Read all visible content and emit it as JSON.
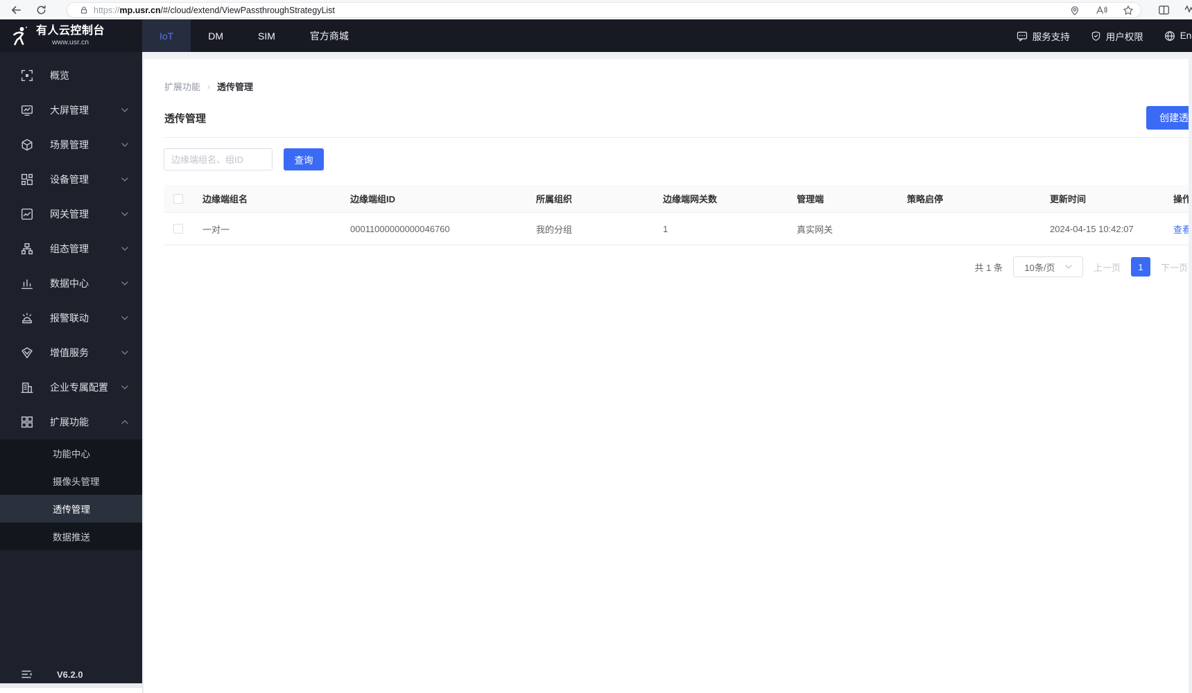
{
  "colors": {
    "accent": "#3b6bf5",
    "toggle_on": "#3e7bfa",
    "navbar_bg": "#171a23",
    "sidebar_bg": "#1c212b"
  },
  "browser": {
    "url_prefix": "https://",
    "url_host": "mp.usr.cn",
    "url_path": "/#/cloud/extend/ViewPassthroughStrategyList"
  },
  "topnav": {
    "logo_title": "有人云控制台",
    "logo_subtitle": "www.usr.cn",
    "tabs": [
      {
        "label": "IoT"
      },
      {
        "label": "DM"
      },
      {
        "label": "SIM"
      },
      {
        "label": "官方商城"
      }
    ],
    "support": "服务支持",
    "permissions": "用户权限",
    "language": "English"
  },
  "sidebar": {
    "items": [
      {
        "label": "概览",
        "icon": "overview-icon"
      },
      {
        "label": "大屏管理",
        "icon": "big-screen-icon"
      },
      {
        "label": "场景管理",
        "icon": "scene-icon"
      },
      {
        "label": "设备管理",
        "icon": "device-icon"
      },
      {
        "label": "网关管理",
        "icon": "gateway-icon"
      },
      {
        "label": "组态管理",
        "icon": "scada-icon"
      },
      {
        "label": "数据中心",
        "icon": "data-center-icon"
      },
      {
        "label": "报警联动",
        "icon": "alarm-icon"
      },
      {
        "label": "增值服务",
        "icon": "value-service-icon"
      },
      {
        "label": "企业专属配置",
        "icon": "enterprise-icon"
      },
      {
        "label": "扩展功能",
        "icon": "extend-icon"
      }
    ],
    "submenu": [
      {
        "label": "功能中心"
      },
      {
        "label": "摄像头管理"
      },
      {
        "label": "透传管理",
        "active": true
      },
      {
        "label": "数据推送"
      }
    ],
    "version": "V6.2.0"
  },
  "breadcrumb": {
    "parent": "扩展功能",
    "current": "透传管理"
  },
  "page": {
    "title": "透传管理",
    "create_button": "创建透传策略",
    "search_placeholder": "边缘端组名、组ID",
    "search_button": "查询"
  },
  "table": {
    "headers": [
      "边缘端组名",
      "边缘端组ID",
      "所属组织",
      "边缘端网关数",
      "管理端",
      "策略启停",
      "更新时间",
      "操作"
    ],
    "rows": [
      {
        "group_name": "一对一",
        "group_id": "00011000000000046760",
        "org": "我的分组",
        "gateway_count": "1",
        "manage_side": "真实网关",
        "enabled": true,
        "updated_at": "2024-04-15 10:42:07",
        "action": "查看"
      }
    ]
  },
  "pagination": {
    "total": "共 1 条",
    "page_size": "10条/页",
    "prev": "上一页",
    "current_page": "1",
    "next": "下一页"
  }
}
